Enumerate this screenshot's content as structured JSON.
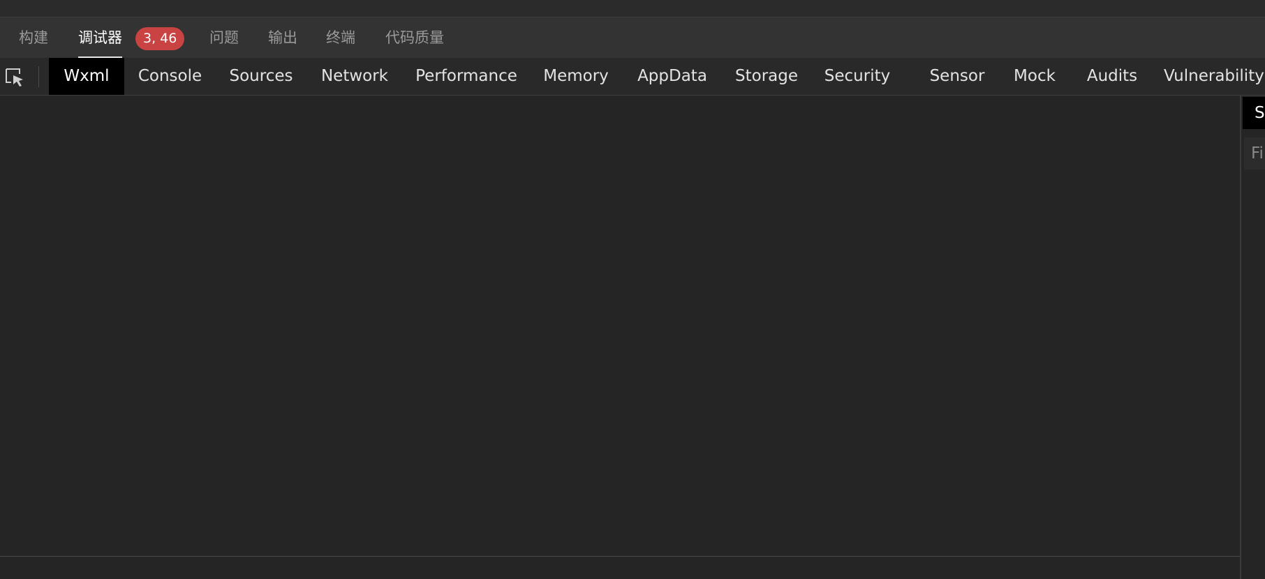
{
  "panel_tabs": [
    {
      "label": "构建"
    },
    {
      "label": "调试器",
      "badge": "3, 46",
      "active": true
    },
    {
      "label": "问题"
    },
    {
      "label": "输出"
    },
    {
      "label": "终端"
    },
    {
      "label": "代码质量"
    }
  ],
  "devtools_tabs": [
    {
      "label": "Wxml",
      "active": true
    },
    {
      "label": "Console"
    },
    {
      "label": "Sources"
    },
    {
      "label": "Network"
    },
    {
      "label": "Performance"
    },
    {
      "label": "Memory"
    },
    {
      "label": "AppData"
    },
    {
      "label": "Storage"
    },
    {
      "label": "Security"
    },
    {
      "label": "Sensor"
    },
    {
      "label": "Mock"
    },
    {
      "label": "Audits"
    },
    {
      "label": "Vulnerability"
    }
  ],
  "side_pane": {
    "tab_label": "St",
    "filter_placeholder": "Fi"
  },
  "colors": {
    "background": "#252525",
    "badge": "#c94343",
    "active_tab_bg": "#000000"
  }
}
